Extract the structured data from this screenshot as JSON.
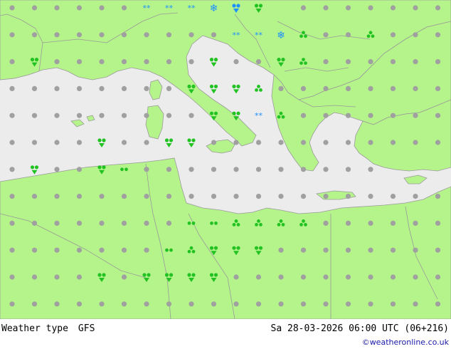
{
  "footer": {
    "label": "Weather type",
    "model": "GFS",
    "datetime": "Sa 28-03-2026 06:00 UTC (06+216)",
    "credit": "©weatheronline.co.uk"
  },
  "colors": {
    "land": "#b5f48a",
    "sea": "#ececec",
    "border": "#9a9a9a",
    "dot": "#a0a0a0",
    "rain": "#22c222",
    "snow": "#1e90ff"
  },
  "grid": {
    "columns": 20,
    "rows": 12,
    "symbols": [
      "ddddddsssSXW.ddddddd",
      "ddddddddddssSTddTddd",
      "dRdddddddWddRTddddddd",
      "ddddddddWRRTdddddddd",
      "dddddddddRRsTddddddd",
      "ddddRddRRddddddddddd",
      "dRddRpddddddddddd",
      "dddddddddddddddddddd",
      "ddddddddwwTTTTdddddd",
      "dddddddwTRRRdddddddd",
      "ddddRdRRRRdddddddddd",
      "dddddddddddddddddddd"
    ]
  }
}
